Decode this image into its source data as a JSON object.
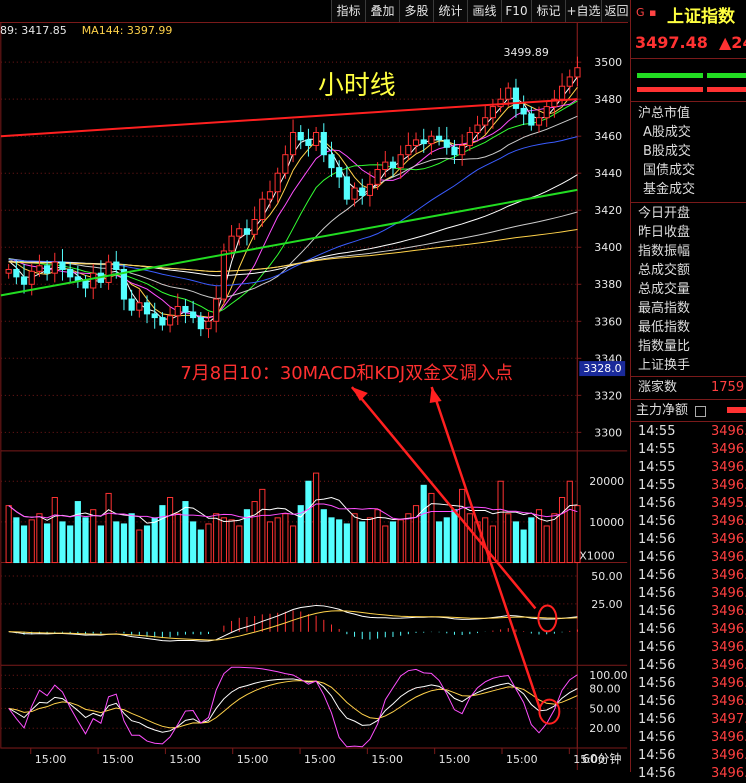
{
  "toolbar": {
    "buttons": [
      "指标",
      "叠加",
      "多股",
      "统计",
      "画线",
      "F10",
      "标记",
      "+自选",
      "返回"
    ]
  },
  "ma_legend": [
    {
      "label": "89: 3417.85",
      "color": "#e8e8e8"
    },
    {
      "label": "MA144: 3397.99",
      "color": "#ffd24a"
    }
  ],
  "annotations": {
    "title": "小时线",
    "peak_label": "3499.89",
    "note": "7月8日10：30MACD和KDJ双金叉调入点",
    "current_price_tag": "3328.0"
  },
  "period_label": "60分钟",
  "colors": {
    "up": "#ff3232",
    "down": "#54ffff",
    "grid": "#7a1a1a",
    "trend_red": "#ff2020",
    "trend_green": "#22dd22"
  },
  "chart_data": [
    {
      "type": "candlestick",
      "panel": "price",
      "y_ticks": [
        3300,
        3320,
        3340,
        3360,
        3380,
        3400,
        3420,
        3440,
        3460,
        3480,
        3500
      ],
      "ylim": [
        3290,
        3512
      ],
      "x_tick_labels": [
        "15:00",
        "15:00",
        "15:00",
        "15:00",
        "15:00",
        "15:00",
        "15:00",
        "15:00",
        "15:00"
      ],
      "close_series": [
        3388,
        3384,
        3380,
        3387,
        3390,
        3386,
        3392,
        3388,
        3384,
        3382,
        3378,
        3386,
        3381,
        3392,
        3388,
        3372,
        3366,
        3370,
        3364,
        3362,
        3358,
        3363,
        3368,
        3365,
        3362,
        3356,
        3360,
        3372,
        3398,
        3406,
        3410,
        3407,
        3415,
        3426,
        3430,
        3440,
        3450,
        3462,
        3458,
        3455,
        3462,
        3450,
        3443,
        3438,
        3426,
        3432,
        3428,
        3434,
        3442,
        3446,
        3443,
        3450,
        3455,
        3458,
        3456,
        3460,
        3458,
        3454,
        3450,
        3455,
        3462,
        3466,
        3470,
        3476,
        3480,
        3486,
        3475,
        3472,
        3466,
        3470,
        3476,
        3480,
        3487,
        3492,
        3497
      ]
    },
    {
      "type": "bar",
      "panel": "volume",
      "y_ticks": [
        10000,
        20000
      ],
      "ylim": [
        0,
        26000
      ],
      "unit_label": "X1000",
      "values": [
        14000,
        11000,
        9000,
        10500,
        12000,
        9500,
        16000,
        10000,
        9000,
        15000,
        11000,
        13000,
        9000,
        17000,
        10000,
        9500,
        12000,
        8000,
        9000,
        11000,
        14000,
        16000,
        12000,
        15000,
        10000,
        8000,
        9500,
        12000,
        11000,
        10500,
        9000,
        13000,
        15000,
        18000,
        10000,
        11000,
        12000,
        9000,
        14000,
        20000,
        22000,
        13000,
        11000,
        10500,
        9500,
        12000,
        10000,
        11000,
        13000,
        9000,
        10000,
        10500,
        12000,
        14000,
        19000,
        17000,
        10000,
        11000,
        13000,
        18000,
        12000,
        10000,
        11000,
        9000,
        20000,
        12000,
        10000,
        8000,
        11000,
        13000,
        9000,
        12000,
        16000,
        20000,
        14000
      ]
    },
    {
      "type": "line",
      "panel": "macd",
      "y_ticks": [
        25.0,
        50.0
      ],
      "tick_labels": [
        "25.00",
        "50.00"
      ],
      "ylim": [
        -30,
        62
      ]
    },
    {
      "type": "line",
      "panel": "kdj",
      "y_ticks": [
        20,
        50,
        80,
        100
      ],
      "tick_labels": [
        "20.00",
        "50.00",
        "80.00",
        "100.00"
      ],
      "ylim": [
        -10,
        115
      ]
    }
  ],
  "sidebar": {
    "header_letter": "G",
    "header_title": "上证指数",
    "price": "3497.48",
    "change": "▲24",
    "section1": [
      "沪总市值",
      "A股成交",
      "B股成交",
      "国债成交",
      "基金成交"
    ],
    "section2": [
      "今日开盘",
      "昨日收盘",
      "指数振幅",
      "总成交额",
      "总成交量",
      "最高指数",
      "最低指数",
      "指数量比",
      "上证换手"
    ],
    "advance_label": "涨家数",
    "advance_value": "1759",
    "flow_label": "主力净额",
    "ticks": [
      {
        "t": "14:55",
        "p": "3496."
      },
      {
        "t": "14:55",
        "p": "3496."
      },
      {
        "t": "14:55",
        "p": "3496."
      },
      {
        "t": "14:55",
        "p": "3496."
      },
      {
        "t": "14:56",
        "p": "3495."
      },
      {
        "t": "14:56",
        "p": "3496."
      },
      {
        "t": "14:56",
        "p": "3496."
      },
      {
        "t": "14:56",
        "p": "3496."
      },
      {
        "t": "14:56",
        "p": "3496."
      },
      {
        "t": "14:56",
        "p": "3496."
      },
      {
        "t": "14:56",
        "p": "3496."
      },
      {
        "t": "14:56",
        "p": "3496."
      },
      {
        "t": "14:56",
        "p": "3496."
      },
      {
        "t": "14:56",
        "p": "3496."
      },
      {
        "t": "14:56",
        "p": "3496."
      },
      {
        "t": "14:56",
        "p": "3496."
      },
      {
        "t": "14:56",
        "p": "3497."
      },
      {
        "t": "14:56",
        "p": "3496."
      },
      {
        "t": "14:56",
        "p": "3496."
      },
      {
        "t": "14:56",
        "p": "3496."
      }
    ]
  }
}
